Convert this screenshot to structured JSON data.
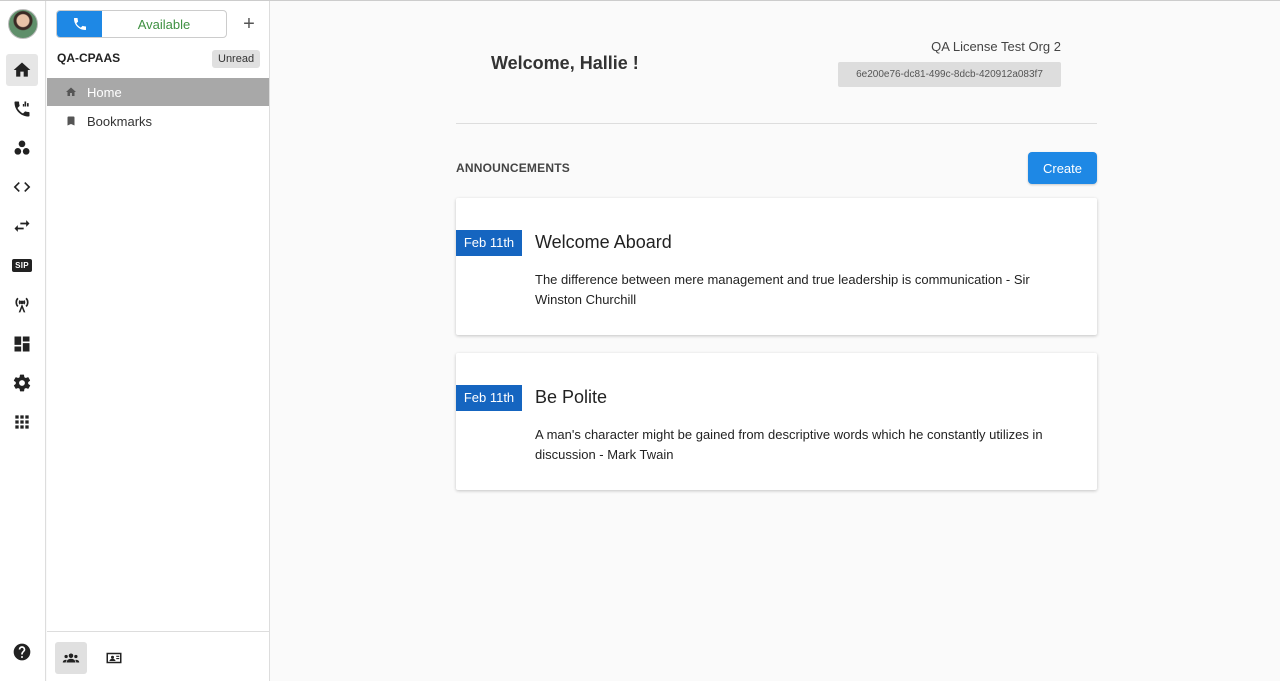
{
  "rail": {
    "icons": [
      "home-icon",
      "phone-icon",
      "groups-icon",
      "code-icon",
      "swap-icon",
      "sip-icon",
      "broadcast-icon",
      "dashboard-icon",
      "settings-icon",
      "apps-icon",
      "help-icon"
    ],
    "sip_label": "SIP"
  },
  "status": {
    "text": "Available",
    "color": "#3f9142",
    "accent": "#1e88e5"
  },
  "sidebar": {
    "add_label": "+",
    "org_name": "QA-CPAAS",
    "unread_label": "Unread",
    "items": [
      {
        "label": "Home"
      },
      {
        "label": "Bookmarks"
      }
    ]
  },
  "main": {
    "welcome": "Welcome, Hallie !",
    "org_title": "QA License Test Org 2",
    "org_id": "6e200e76-dc81-499c-8dcb-420912a083f7",
    "section_title": "ANNOUNCEMENTS",
    "create_label": "Create",
    "announcements": [
      {
        "date": "Feb 11th",
        "title": "Welcome Aboard",
        "body": "The difference between mere management and true leadership is communication - Sir Winston Churchill"
      },
      {
        "date": "Feb 11th",
        "title": "Be Polite",
        "body": "A man's character might be gained from descriptive words which he constantly utilizes in discussion - Mark Twain"
      }
    ]
  }
}
